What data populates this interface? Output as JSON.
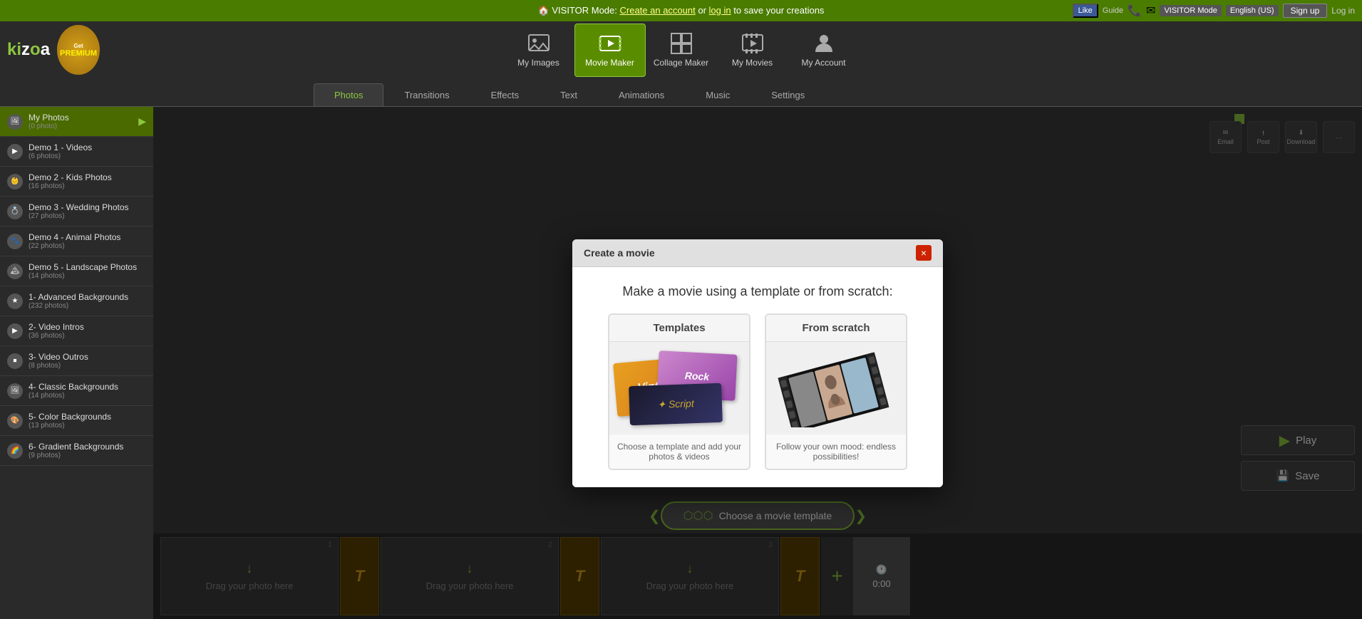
{
  "topbar": {
    "visitor_text": "VISITOR Mode:",
    "create_account": "Create an account",
    "or": "or",
    "log_in": "log in",
    "save_text": "to save your creations",
    "signup_label": "Sign up",
    "login_label": "Log in",
    "fb_like": "Like",
    "guide": "Guide",
    "visitor_mode": "VISITOR Mode",
    "language": "English (US)"
  },
  "header": {
    "logo": "kizoa",
    "premium_get": "Get",
    "premium_label": "PREMIUM",
    "nav": [
      {
        "id": "my-images",
        "label": "My Images",
        "icon": "image"
      },
      {
        "id": "movie-maker",
        "label": "Movie Maker",
        "icon": "film",
        "active": true
      },
      {
        "id": "collage-maker",
        "label": "Collage Maker",
        "icon": "collage"
      },
      {
        "id": "my-movies",
        "label": "My Movies",
        "icon": "movie"
      },
      {
        "id": "my-account",
        "label": "My Account",
        "icon": "account"
      }
    ]
  },
  "tabs": [
    {
      "id": "photos",
      "label": "Photos",
      "active": true
    },
    {
      "id": "transitions",
      "label": "Transitions"
    },
    {
      "id": "effects",
      "label": "Effects"
    },
    {
      "id": "text",
      "label": "Text"
    },
    {
      "id": "animations",
      "label": "Animations"
    },
    {
      "id": "music",
      "label": "Music"
    },
    {
      "id": "settings",
      "label": "Settings"
    }
  ],
  "sidebar": {
    "items": [
      {
        "id": "my-photos",
        "name": "My Photos",
        "count": "(0 photo)",
        "active": true
      },
      {
        "id": "demo1",
        "name": "Demo 1 - Videos",
        "count": "(6 photos)"
      },
      {
        "id": "demo2",
        "name": "Demo 2 - Kids Photos",
        "count": "(16 photos)"
      },
      {
        "id": "demo3",
        "name": "Demo 3 - Wedding Photos",
        "count": "(27 photos)"
      },
      {
        "id": "demo4",
        "name": "Demo 4 - Animal Photos",
        "count": "(22 photos)"
      },
      {
        "id": "demo5",
        "name": "Demo 5 - Landscape Photos",
        "count": "(14 photos)"
      },
      {
        "id": "advanced-bg",
        "name": "1- Advanced Backgrounds",
        "count": "(232 photos)"
      },
      {
        "id": "video-intros",
        "name": "2- Video Intros",
        "count": "(36 photos)"
      },
      {
        "id": "video-outros",
        "name": "3- Video Outros",
        "count": "(8 photos)"
      },
      {
        "id": "classic-bg",
        "name": "4- Classic Backgrounds",
        "count": "(14 photos)"
      },
      {
        "id": "color-bg",
        "name": "5- Color Backgrounds",
        "count": "(13 photos)"
      },
      {
        "id": "gradient-bg",
        "name": "6- Gradient Backgrounds",
        "count": "(9 photos)"
      }
    ]
  },
  "modal": {
    "title": "Create a movie",
    "subtitle": "Make a movie using a template or from scratch:",
    "close_label": "×",
    "options": [
      {
        "id": "templates",
        "title": "Templates",
        "desc": "Choose a template and add your photos & videos"
      },
      {
        "id": "from-scratch",
        "title": "From scratch",
        "desc": "Follow your own mood: endless possibilities!"
      }
    ]
  },
  "timeline": {
    "choose_template": "Choose a movie template",
    "slots": [
      {
        "number": "1",
        "label": "Drag your photo here"
      },
      {
        "number": "2",
        "label": "Drag your photo here"
      },
      {
        "number": "3",
        "label": "Drag your photo here"
      }
    ],
    "timer": "0:00"
  },
  "share": {
    "email_label": "Email",
    "facebook_label": "Post",
    "download_label": "Download",
    "more_label": "..."
  },
  "player": {
    "play_label": "Play",
    "save_label": "Save"
  }
}
